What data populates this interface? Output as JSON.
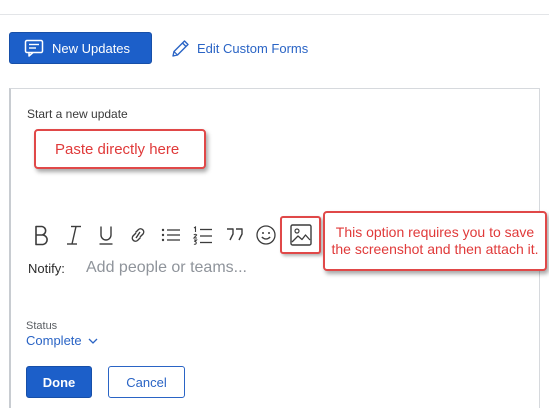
{
  "header": {
    "new_updates_label": "New Updates",
    "new_updates_icon": "chat-lines-icon",
    "edit_forms_label": "Edit Custom Forms",
    "edit_forms_icon": "pencil-icon"
  },
  "composer": {
    "placeholder_label": "Start a new update",
    "toolbar": [
      {
        "name": "bold",
        "icon": "bold-icon"
      },
      {
        "name": "italic",
        "icon": "italic-icon"
      },
      {
        "name": "underline",
        "icon": "underline-icon"
      },
      {
        "name": "link",
        "icon": "link-icon"
      },
      {
        "name": "bulleted-list",
        "icon": "bulleted-list-icon"
      },
      {
        "name": "numbered-list",
        "icon": "numbered-list-icon"
      },
      {
        "name": "quote",
        "icon": "quote-icon"
      },
      {
        "name": "emoji",
        "icon": "emoji-icon"
      },
      {
        "name": "image",
        "icon": "image-icon"
      }
    ]
  },
  "annotations": {
    "paste_callout": "Paste directly here",
    "image_callout": "This option requires you to save the screenshot and then attach it.",
    "callout_color": "#e04848"
  },
  "notify": {
    "label": "Notify:",
    "placeholder": "Add people or teams..."
  },
  "status": {
    "label": "Status",
    "value": "Complete"
  },
  "actions": {
    "done_label": "Done",
    "cancel_label": "Cancel"
  },
  "colors": {
    "primary": "#1c5fc9",
    "link": "#2a64c5",
    "annotation": "#e04848"
  }
}
